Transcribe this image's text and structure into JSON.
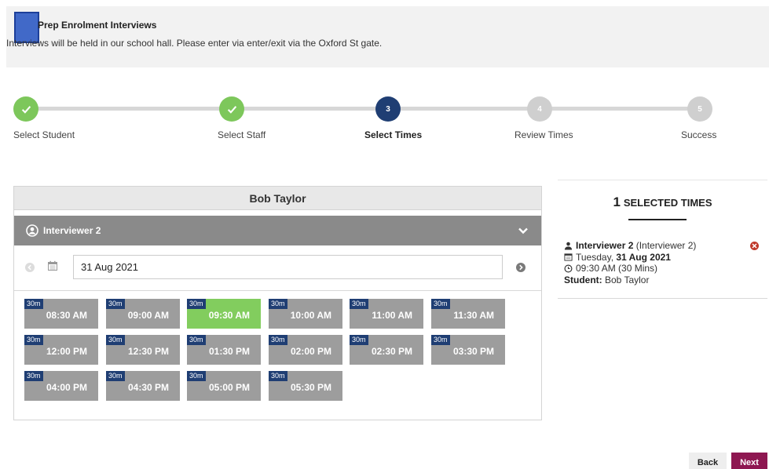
{
  "header": {
    "title": "Prep Enrolment Interviews",
    "description": "Interviews will be held in our school hall. Please enter via enter/exit via the Oxford St gate."
  },
  "steps": [
    {
      "number": "1",
      "label": "Select Student",
      "status": "done"
    },
    {
      "number": "2",
      "label": "Select Staff",
      "status": "done"
    },
    {
      "number": "3",
      "label": "Select Times",
      "status": "current"
    },
    {
      "number": "4",
      "label": "Review Times",
      "status": "todo"
    },
    {
      "number": "5",
      "label": "Success",
      "status": "todo"
    }
  ],
  "panel": {
    "student_name": "Bob Taylor",
    "interviewer": "Interviewer 2",
    "date": "31 Aug 2021",
    "slots": [
      {
        "duration": "30m",
        "time": "08:30 AM",
        "selected": false
      },
      {
        "duration": "30m",
        "time": "09:00 AM",
        "selected": false
      },
      {
        "duration": "30m",
        "time": "09:30 AM",
        "selected": true
      },
      {
        "duration": "30m",
        "time": "10:00 AM",
        "selected": false
      },
      {
        "duration": "30m",
        "time": "11:00 AM",
        "selected": false
      },
      {
        "duration": "30m",
        "time": "11:30 AM",
        "selected": false
      },
      {
        "duration": "30m",
        "time": "12:00 PM",
        "selected": false
      },
      {
        "duration": "30m",
        "time": "12:30 PM",
        "selected": false
      },
      {
        "duration": "30m",
        "time": "01:30 PM",
        "selected": false
      },
      {
        "duration": "30m",
        "time": "02:00 PM",
        "selected": false
      },
      {
        "duration": "30m",
        "time": "02:30 PM",
        "selected": false
      },
      {
        "duration": "30m",
        "time": "03:30 PM",
        "selected": false
      },
      {
        "duration": "30m",
        "time": "04:00 PM",
        "selected": false
      },
      {
        "duration": "30m",
        "time": "04:30 PM",
        "selected": false
      },
      {
        "duration": "30m",
        "time": "05:00 PM",
        "selected": false
      },
      {
        "duration": "30m",
        "time": "05:30 PM",
        "selected": false
      }
    ]
  },
  "selected": {
    "count": "1",
    "heading": "SELECTED TIMES",
    "booking": {
      "interviewer": "Interviewer 2",
      "interviewer_detail": "(Interviewer 2)",
      "day": "Tuesday,",
      "date": "31 Aug 2021",
      "time": "09:30 AM (30 Mins)",
      "student_label": "Student:",
      "student": "Bob Taylor"
    }
  },
  "footer": {
    "back_label": "Back",
    "next_label": "Next"
  },
  "colors": {
    "step_done": "#7dc75b",
    "step_current": "#1f3e73",
    "step_todo": "#cfcfcf",
    "slot": "#9d9d9d",
    "slot_selected": "#82cd5e",
    "duration_badge": "#1f3e73",
    "next_button": "#8e1751"
  }
}
